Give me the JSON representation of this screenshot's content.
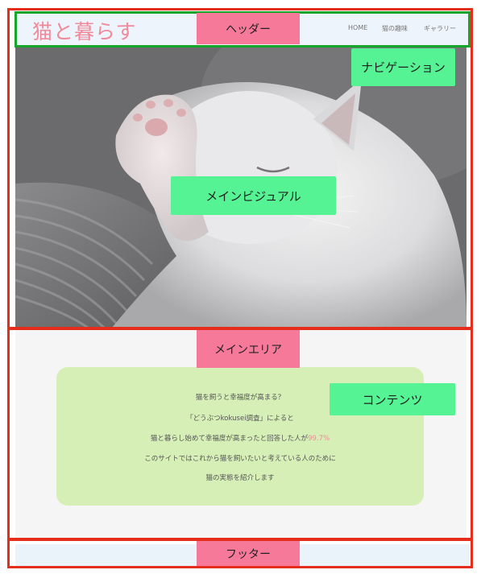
{
  "header": {
    "site_title": "猫と暮らす",
    "nav_items": [
      "HOME",
      "猫の趣味",
      "ギャラリー"
    ]
  },
  "annotations": {
    "header": "ヘッダー",
    "navigation": "ナビゲーション",
    "main_visual": "メインビジュアル",
    "main_area": "メインエリア",
    "contents": "コンテンツ",
    "footer": "フッター"
  },
  "content": {
    "line1": "猫を飼うと幸福度が高まる？",
    "line2": "「どうぶつkokusei調査」によると",
    "line3_text": "猫と暮らし始めて幸福度が高まったと回答した人が",
    "line3_highlight": "99.7%",
    "line4": "このサイトではこれから猫を飼いたいと考えている人のために",
    "line5": "猫の実態を紹介します"
  },
  "colors": {
    "outline_red": "#e42d1a",
    "outline_green": "#18a52b",
    "label_pink": "#f7799a",
    "label_green": "#55f393",
    "content_bg": "#d6efb6",
    "logo": "#f08a9b"
  }
}
